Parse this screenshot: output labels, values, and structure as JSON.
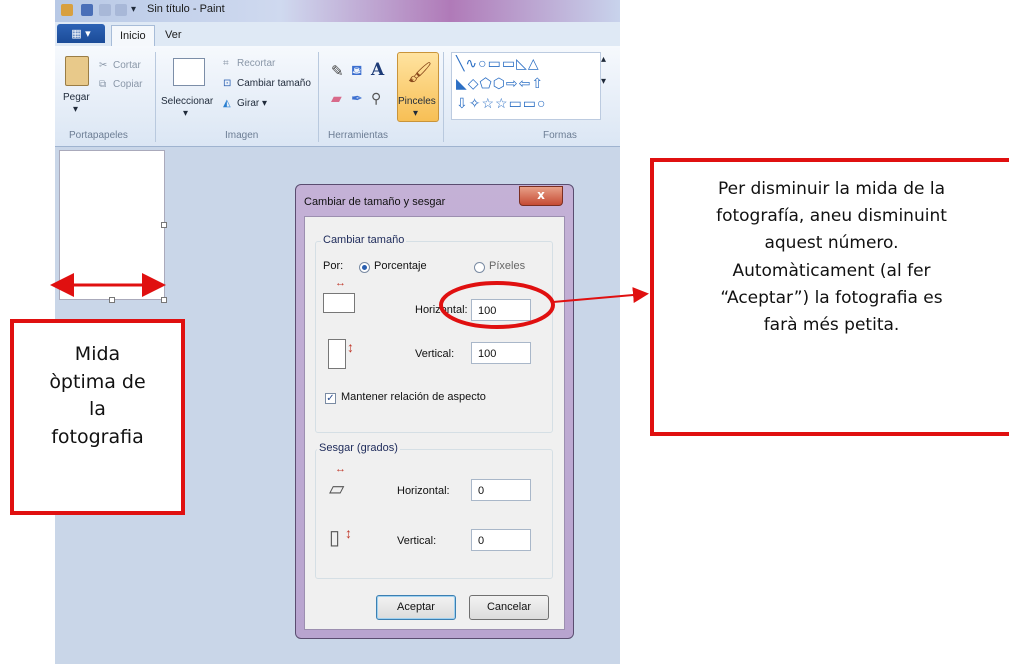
{
  "window": {
    "title": "Sin título - Paint",
    "tabs": [
      "Inicio",
      "Ver"
    ]
  },
  "ribbon": {
    "portapapeles": {
      "paste_label": "Pegar",
      "cut_label": "Cortar",
      "copy_label": "Copiar",
      "group_label": "Portapapeles"
    },
    "imagen": {
      "select_label": "Seleccionar",
      "crop_label": "Recortar",
      "resize_label": "Cambiar tamaño",
      "rotate_label": "Girar",
      "group_label": "Imagen"
    },
    "herramientas": {
      "brushes_label": "Pinceles",
      "group_label": "Herramientas",
      "text_tool": "A"
    },
    "formas": {
      "group_label": "Formas"
    }
  },
  "dialog": {
    "title": "Cambiar de tamaño y sesgar",
    "close_label": "x",
    "resize_section": "Cambiar tamaño",
    "by_label": "Por:",
    "percent_label": "Porcentaje",
    "pixels_label": "Píxeles",
    "horizontal_label": "Horizontal:",
    "vertical_label": "Vertical:",
    "horizontal_value": "100",
    "vertical_value": "100",
    "aspect_label": "Mantener relación de aspecto",
    "skew_section": "Sesgar (grados)",
    "skew_horizontal_label": "Horizontal:",
    "skew_vertical_label": "Vertical:",
    "skew_horizontal_value": "0",
    "skew_vertical_value": "0",
    "ok_label": "Aceptar",
    "cancel_label": "Cancelar"
  },
  "annotations": {
    "left_box": [
      "Mida",
      "òptima de",
      "la",
      "fotografia"
    ],
    "right_box": [
      "Per disminuir la mida de la",
      "fotografía, aneu disminuint",
      "aquest número.",
      "Automàticament (al fer",
      "“Aceptar”) la fotografia es",
      "farà més petita."
    ]
  },
  "colors": {
    "annotation_red": "#e01010",
    "dialog_frame": "#c4b1d6"
  }
}
